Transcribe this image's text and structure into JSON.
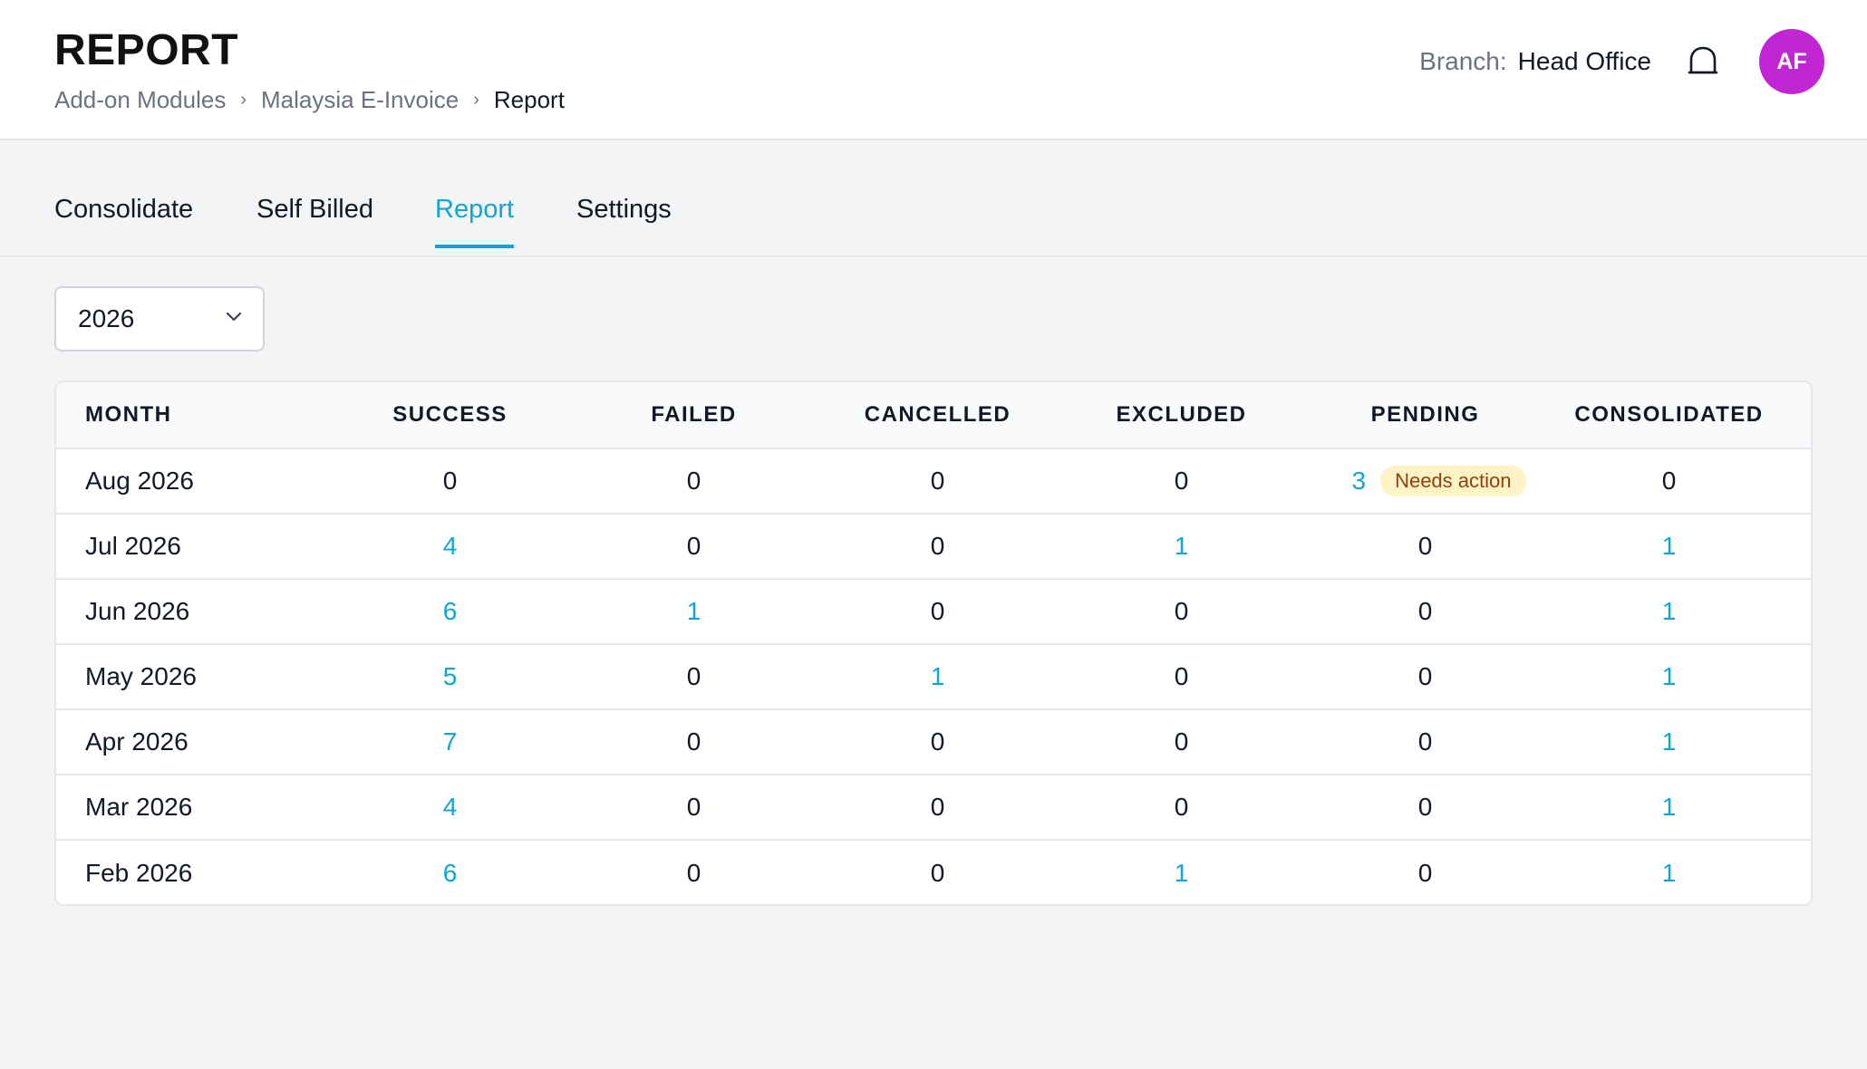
{
  "header": {
    "title": "REPORT",
    "breadcrumb": [
      "Add-on Modules",
      "Malaysia E-Invoice",
      "Report"
    ],
    "breadcrumb_separator": "›",
    "branch_label": "Branch:",
    "branch_value": "Head Office",
    "avatar_initials": "AF",
    "avatar_color": "#c026d3",
    "bell_icon": "bell-icon"
  },
  "tabs": [
    {
      "label": "Consolidate",
      "active": false
    },
    {
      "label": "Self Billed",
      "active": false
    },
    {
      "label": "Report",
      "active": true
    },
    {
      "label": "Settings",
      "active": false
    }
  ],
  "filters": {
    "year": "2026",
    "year_icon": "chevron-down-icon"
  },
  "colors": {
    "accent": "#0ea5d9",
    "badge_bg": "#fef3c7",
    "badge_text": "#92400e"
  },
  "table": {
    "columns": [
      "MONTH",
      "SUCCESS",
      "FAILED",
      "CANCELLED",
      "EXCLUDED",
      "PENDING",
      "CONSOLIDATED"
    ],
    "rows": [
      {
        "month": "Aug 2026",
        "success": "0",
        "failed": "0",
        "cancelled": "0",
        "excluded": "0",
        "pending": "3",
        "pending_badge": "Needs action",
        "consolidated": "0"
      },
      {
        "month": "Jul 2026",
        "success": "4",
        "failed": "0",
        "cancelled": "0",
        "excluded": "1",
        "pending": "0",
        "consolidated": "1"
      },
      {
        "month": "Jun 2026",
        "success": "6",
        "failed": "1",
        "cancelled": "0",
        "excluded": "0",
        "pending": "0",
        "consolidated": "1"
      },
      {
        "month": "May 2026",
        "success": "5",
        "failed": "0",
        "cancelled": "1",
        "excluded": "0",
        "pending": "0",
        "consolidated": "1"
      },
      {
        "month": "Apr 2026",
        "success": "7",
        "failed": "0",
        "cancelled": "0",
        "excluded": "0",
        "pending": "0",
        "consolidated": "1"
      },
      {
        "month": "Mar 2026",
        "success": "4",
        "failed": "0",
        "cancelled": "0",
        "excluded": "0",
        "pending": "0",
        "consolidated": "1"
      },
      {
        "month": "Feb 2026",
        "success": "6",
        "failed": "0",
        "cancelled": "0",
        "excluded": "1",
        "pending": "0",
        "consolidated": "1"
      }
    ]
  }
}
